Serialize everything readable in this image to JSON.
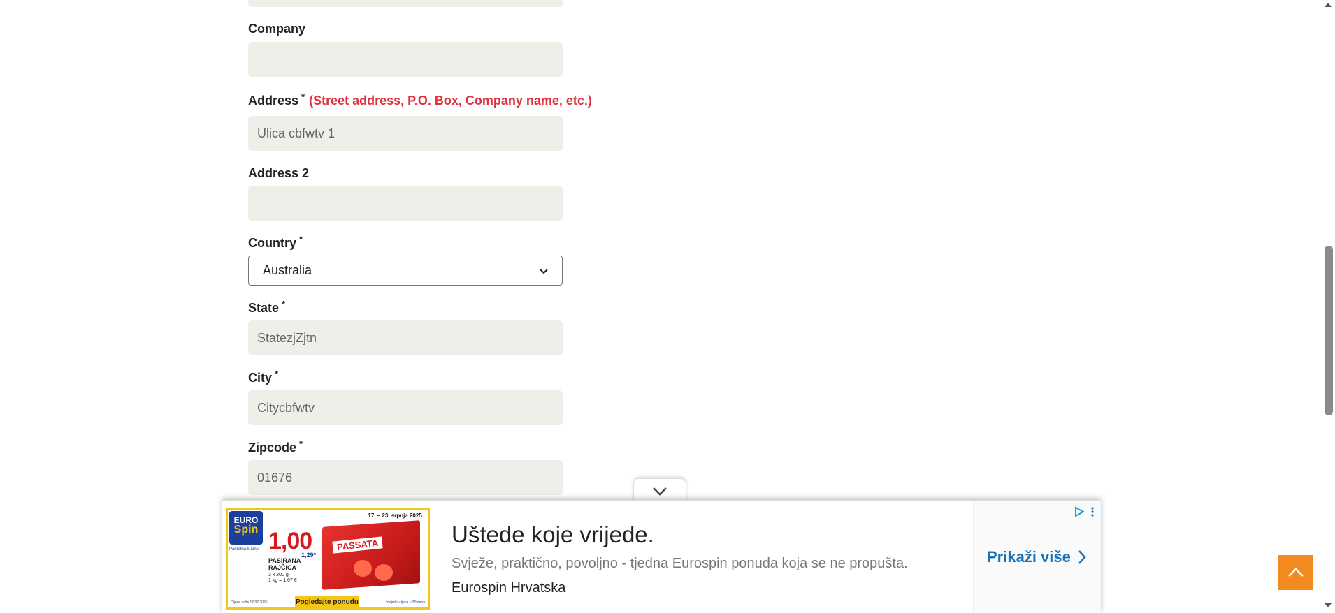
{
  "form": {
    "company": {
      "label": "Company",
      "value": ""
    },
    "address": {
      "label": "Address",
      "required_mark": "*",
      "hint": "(Street address, P.O. Box, Company name, etc.)",
      "value": "Ulica cbfwtv 1"
    },
    "address2": {
      "label": "Address 2",
      "value": ""
    },
    "country": {
      "label": "Country",
      "required_mark": "*",
      "selected": "Australia"
    },
    "state": {
      "label": "State",
      "required_mark": "*",
      "value": "StatezjZjtn"
    },
    "city": {
      "label": "City",
      "required_mark": "*",
      "value": "Citycbfwtv"
    },
    "zipcode": {
      "label": "Zipcode",
      "required_mark": "*",
      "value": "01676"
    }
  },
  "ad": {
    "title": "Uštede koje vrijede.",
    "description": "Svježe, praktično, povoljno - tjedna Eurospin ponuda koja se ne propušta.",
    "brand": "Eurospin Hrvatska",
    "cta": "Prikaži više",
    "image": {
      "logo_top": "EURO",
      "logo_bottom": "Spin",
      "logo_sub": "Pametna kupnja",
      "date": "17. – 23. srpnja 2025.",
      "price_main": "1,00",
      "price_alt": "1,29*",
      "product": "PASIRANA RAJČICA",
      "product_qty": "3 x 200 g",
      "unit_price": "1 kg = 1,67 €",
      "box_label": "PASSATA",
      "button": "Pogledajte ponudu",
      "footnote": "Cijene važe 17.07.2025.",
      "footnote_right": "*najniža cijena u 30 dana"
    }
  },
  "colors": {
    "input_bg": "#efeee8",
    "hint_red": "#e0303d",
    "ad_link_blue": "#1a73b8",
    "back_to_top": "#f28b1f"
  }
}
